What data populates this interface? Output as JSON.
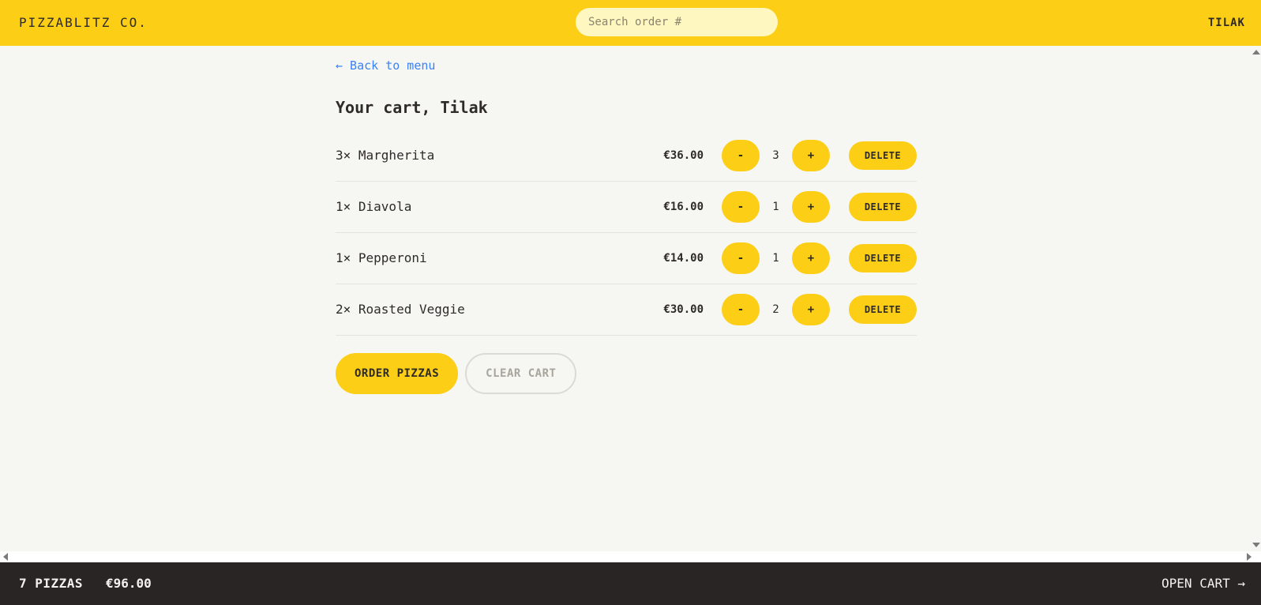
{
  "header": {
    "brand": "PIZZABLITZ CO.",
    "search_placeholder": "Search order #",
    "search_value": "",
    "username": "TILAK"
  },
  "main": {
    "back_link": "← Back to menu",
    "title": "Your cart, Tilak",
    "items": [
      {
        "name": "3× Margherita",
        "price": "€36.00",
        "quantity": "3",
        "minus_label": "-",
        "plus_label": "+",
        "delete_label": "DELETE"
      },
      {
        "name": "1× Diavola",
        "price": "€16.00",
        "quantity": "1",
        "minus_label": "-",
        "plus_label": "+",
        "delete_label": "DELETE"
      },
      {
        "name": "1× Pepperoni",
        "price": "€14.00",
        "quantity": "1",
        "minus_label": "-",
        "plus_label": "+",
        "delete_label": "DELETE"
      },
      {
        "name": "2× Roasted Veggie",
        "price": "€30.00",
        "quantity": "2",
        "minus_label": "-",
        "plus_label": "+",
        "delete_label": "DELETE"
      }
    ],
    "order_button": "ORDER PIZZAS",
    "clear_button": "CLEAR CART"
  },
  "footer": {
    "count": "7 PIZZAS",
    "total": "€96.00",
    "open_cart": "OPEN CART →"
  },
  "colors": {
    "accent": "#fcce16",
    "background": "#f6f6f3",
    "footer_bg": "#292524",
    "link": "#3b82f6",
    "text": "#2e2b28"
  }
}
